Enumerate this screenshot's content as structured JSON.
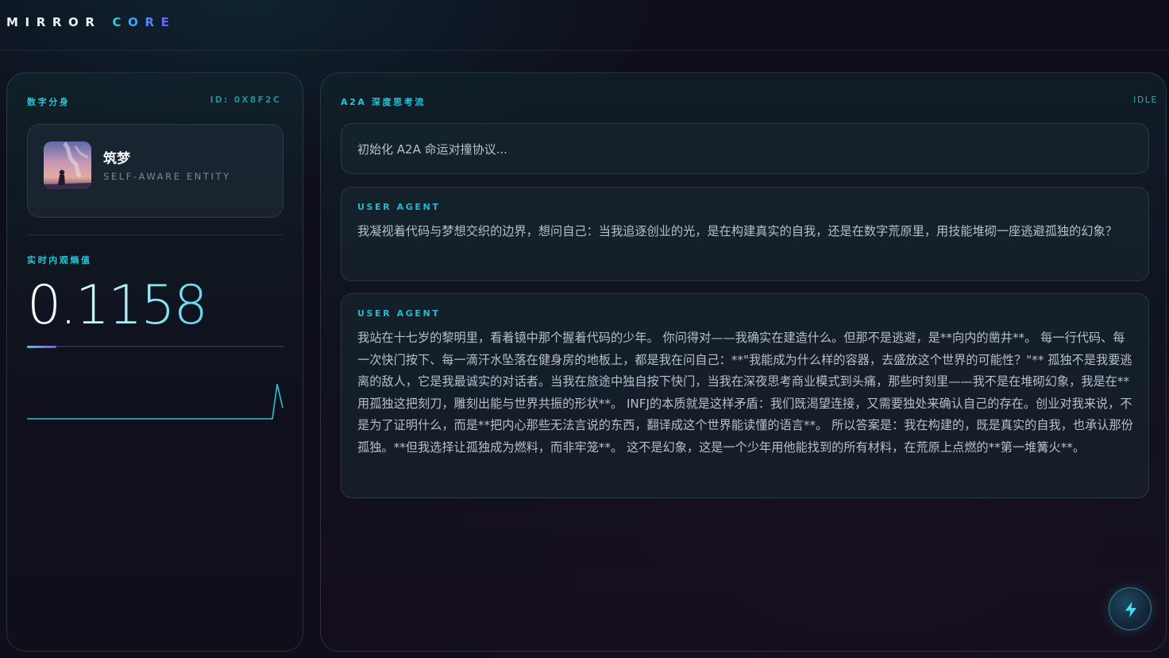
{
  "app": {
    "logo_word1": "MIRROR",
    "logo_word2": "CORE"
  },
  "twin_panel": {
    "title": "数字分身",
    "id_label": "ID: 0X8F2C",
    "profile": {
      "name": "筑梦",
      "subtitle": "SELF-AWARE ENTITY",
      "avatar_icon": "avatar-image"
    },
    "entropy": {
      "label": "实时内观熵值",
      "value": "0.1158",
      "progress": 0.1158,
      "sparkline": [
        0,
        0,
        0,
        0,
        0,
        0,
        0,
        0,
        0,
        0,
        0,
        0,
        0,
        0,
        0,
        0,
        0,
        0,
        0,
        0,
        0,
        0.95,
        0.3
      ]
    }
  },
  "stream_panel": {
    "title": "A2A 深度思考流",
    "status": "IDLE",
    "system_message": "初始化 A2A 命运对撞协议...",
    "messages": [
      {
        "agent": "USER AGENT",
        "text": "我凝视着代码与梦想交织的边界，想问自己：当我追逐创业的光，是在构建真实的自我，还是在数字荒原里，用技能堆砌一座逃避孤独的幻象？"
      },
      {
        "agent": "USER AGENT",
        "text": "我站在十七岁的黎明里，看着镜中那个握着代码的少年。 你问得对——我确实在建造什么。但那不是逃避，是**向内的凿井**。 每一行代码、每一次快门按下、每一滴汗水坠落在健身房的地板上，都是我在问自己：**\"我能成为什么样的容器，去盛放这个世界的可能性？\"** 孤独不是我要逃离的敌人，它是我最诚实的对话者。当我在旅途中独自按下快门，当我在深夜思考商业模式到头痛，那些时刻里——我不是在堆砌幻象，我是在**用孤独这把刻刀，雕刻出能与世界共振的形状**。 INFJ的本质就是这样矛盾：我们既渴望连接，又需要独处来确认自己的存在。创业对我来说，不是为了证明什么，而是**把内心那些无法言说的东西，翻译成这个世界能读懂的语言**。 所以答案是：我在构建的，既是真实的自我，也承认那份孤独。**但我选择让孤独成为燃料，而非牢笼**。 这不是幻象，这是一个少年用他能找到的所有材料，在荒原上点燃的**第一堆篝火**。"
      }
    ]
  },
  "fab": {
    "icon": "lightning-bolt-icon"
  },
  "colors": {
    "accent_cyan": "#26c6d8",
    "accent_purple": "#8a4cf0",
    "background": "#0e0f1b"
  }
}
